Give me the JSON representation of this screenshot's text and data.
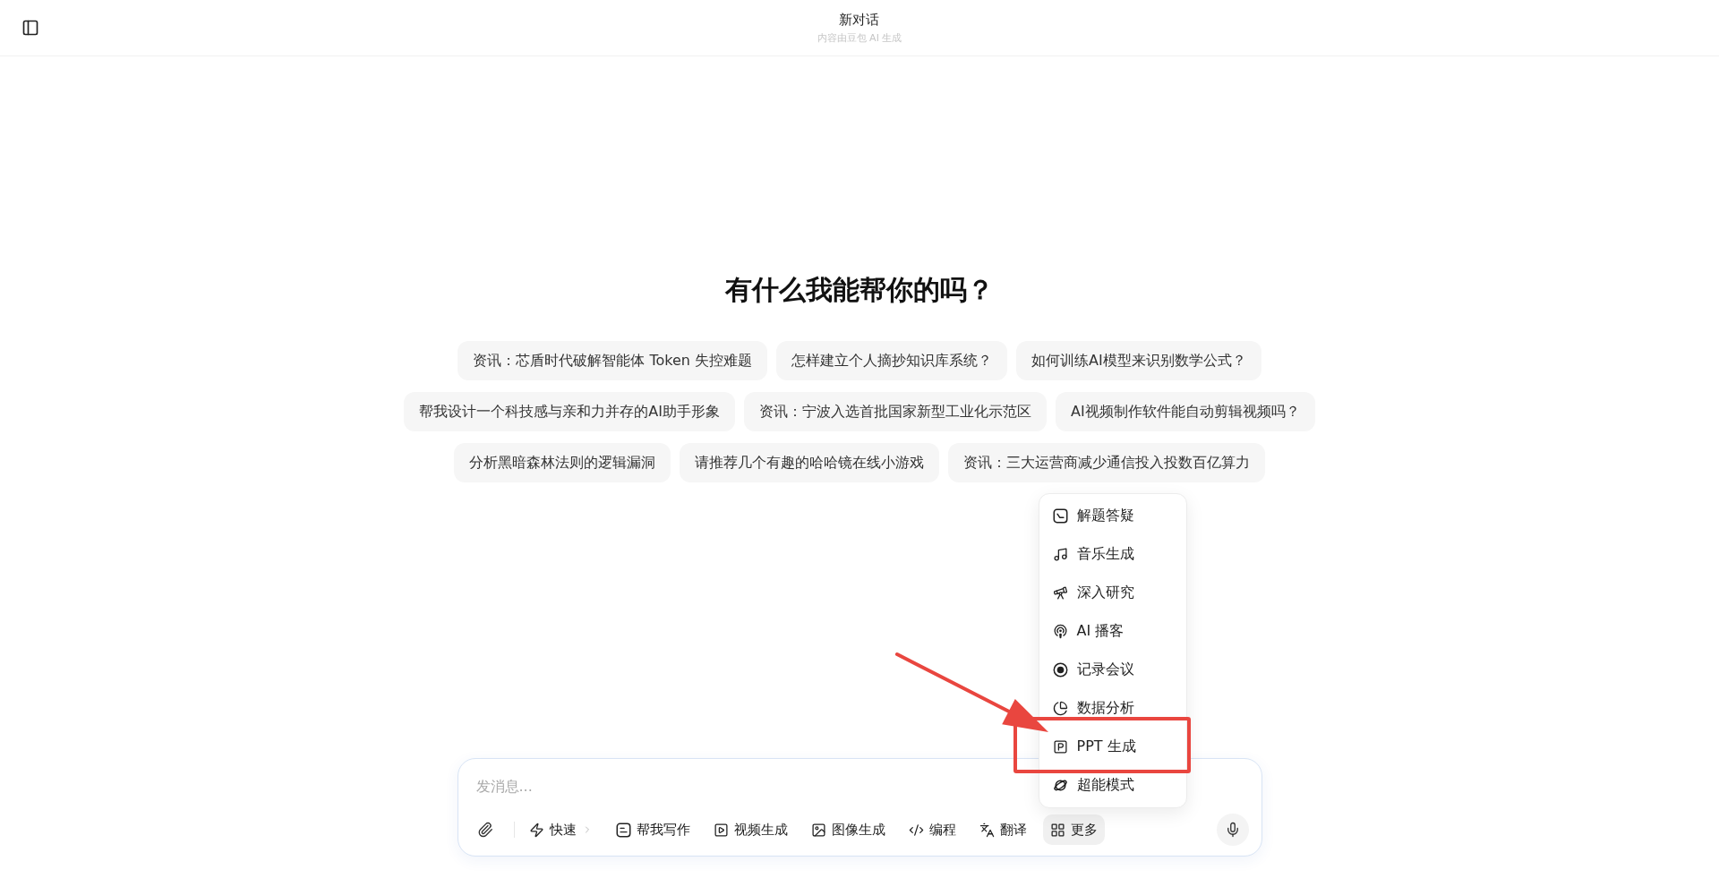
{
  "header": {
    "title": "新对话",
    "subtitle": "内容由豆包 AI 生成"
  },
  "heading": "有什么我能帮你的吗？",
  "suggestion_rows": [
    [
      "资讯：芯盾时代破解智能体 Token 失控难题",
      "怎样建立个人摘抄知识库系统？",
      "如何训练AI模型来识别数学公式？"
    ],
    [
      "帮我设计一个科技感与亲和力并存的AI助手形象",
      "资讯：宁波入选首批国家新型工业化示范区",
      "AI视频制作软件能自动剪辑视频吗？"
    ],
    [
      "分析黑暗森林法则的逻辑漏洞",
      "请推荐几个有趣的哈哈镜在线小游戏",
      "资讯：三大运营商减少通信投入投数百亿算力"
    ]
  ],
  "composer": {
    "placeholder": "发消息...",
    "tools": [
      {
        "kind": "dropdown",
        "label": "快速",
        "selected": false
      },
      {
        "kind": "button",
        "label": "帮我写作",
        "selected": false
      },
      {
        "kind": "button",
        "label": "视频生成",
        "selected": false
      },
      {
        "kind": "button",
        "label": "图像生成",
        "selected": false
      },
      {
        "kind": "button",
        "label": "编程",
        "selected": false
      },
      {
        "kind": "button",
        "label": "翻译",
        "selected": false
      },
      {
        "kind": "button",
        "label": "更多",
        "selected": true
      }
    ]
  },
  "more_menu": {
    "items": [
      {
        "label": "解题答疑",
        "highlighted": false
      },
      {
        "label": "音乐生成",
        "highlighted": false
      },
      {
        "label": "深入研究",
        "highlighted": false
      },
      {
        "label": "AI 播客",
        "highlighted": false
      },
      {
        "label": "记录会议",
        "highlighted": false
      },
      {
        "label": "数据分析",
        "highlighted": false
      },
      {
        "label": "PPT 生成",
        "highlighted": true
      },
      {
        "label": "超能模式",
        "highlighted": false
      }
    ]
  }
}
